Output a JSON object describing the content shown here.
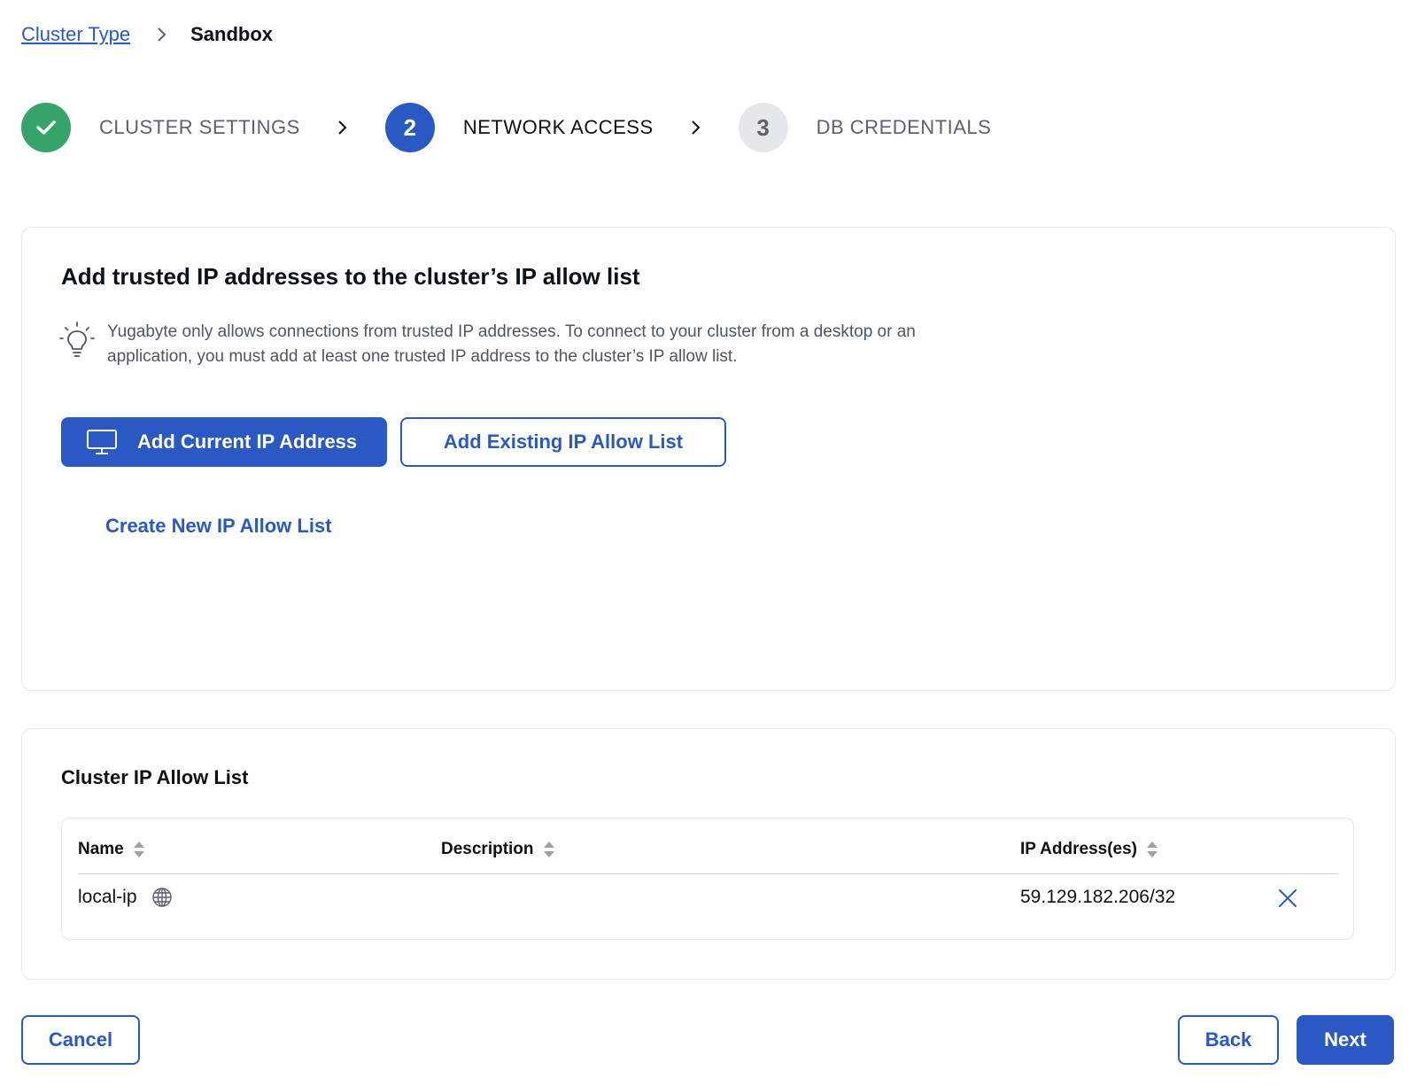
{
  "breadcrumb": {
    "parent": "Cluster Type",
    "current": "Sandbox"
  },
  "stepper": {
    "steps": [
      {
        "number": "",
        "label": "CLUSTER SETTINGS",
        "state": "done",
        "icon": "check-icon"
      },
      {
        "number": "2",
        "label": "NETWORK ACCESS",
        "state": "active"
      },
      {
        "number": "3",
        "label": "DB CREDENTIALS",
        "state": "pending"
      }
    ]
  },
  "network_card": {
    "title": "Add trusted IP addresses to the cluster’s IP allow list",
    "hint": "Yugabyte only allows connections from trusted IP addresses. To connect to your cluster from a desktop or an application, you must add at least one trusted IP address to the cluster’s IP allow list.",
    "hint_icon": "lightbulb-icon",
    "add_current_ip_label": "Add Current IP Address",
    "add_current_ip_icon": "monitor-icon",
    "add_existing_label": "Add Existing IP Allow List",
    "create_new_label": "Create New IP Allow List"
  },
  "allow_list": {
    "title": "Cluster IP Allow List",
    "columns": [
      "Name",
      "Description",
      "IP Address(es)"
    ],
    "rows": [
      {
        "name": "local-ip",
        "description": "",
        "ip": "59.129.182.206/32",
        "name_icon": "globe-icon",
        "action_icon": "close-icon"
      }
    ]
  },
  "footer": {
    "cancel_label": "Cancel",
    "back_label": "Back",
    "next_label": "Next"
  },
  "colors": {
    "primary": "#2b59c3",
    "success": "#36a36a",
    "pending": "#e5e7eb",
    "text": "#0b1117",
    "muted": "#5b6170"
  }
}
